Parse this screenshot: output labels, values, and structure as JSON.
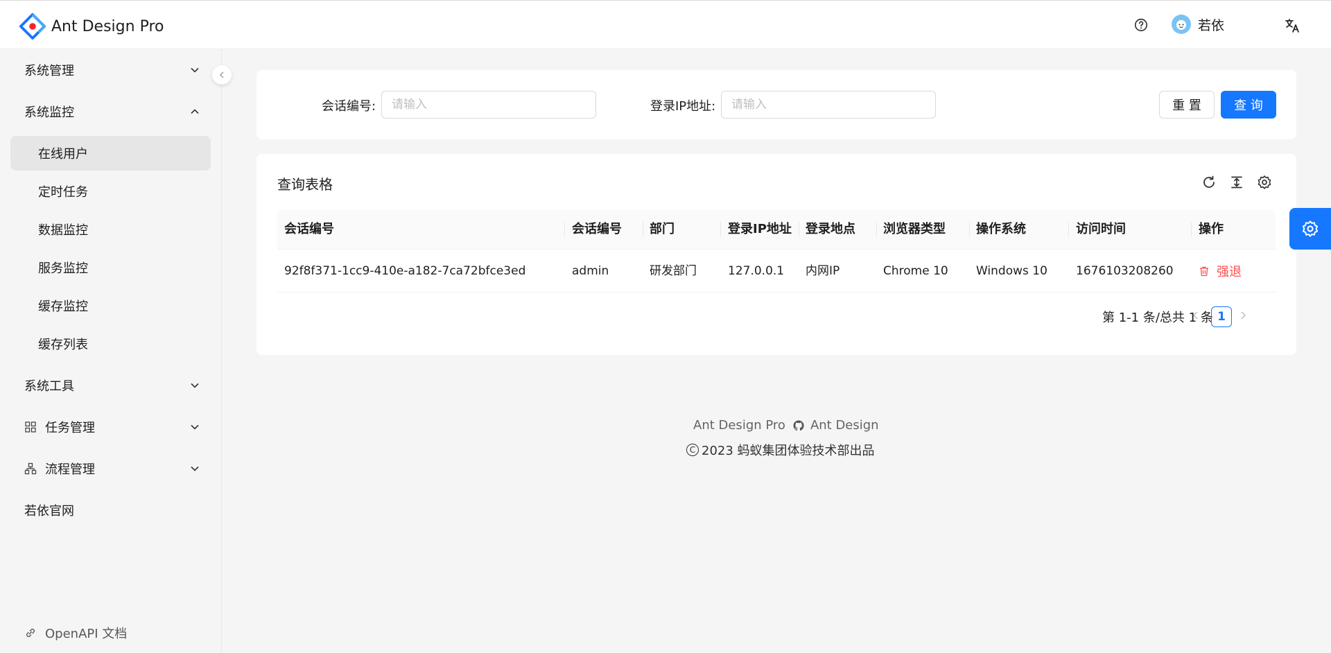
{
  "header": {
    "app_name": "Ant Design Pro",
    "user_name": "若依",
    "icons": {
      "help": "question-circle-icon",
      "language": "translation-icon"
    }
  },
  "sidebar": {
    "groups": [
      {
        "label": "系统管理",
        "expanded": false
      },
      {
        "label": "系统监控",
        "expanded": true,
        "items": [
          "在线用户",
          "定时任务",
          "数据监控",
          "服务监控",
          "缓存监控",
          "缓存列表"
        ]
      },
      {
        "label": "系统工具",
        "expanded": false
      },
      {
        "label": "任务管理",
        "expanded": false,
        "icon": "appstore-icon"
      },
      {
        "label": "流程管理",
        "expanded": false,
        "icon": "partition-icon"
      }
    ],
    "selected": "在线用户",
    "link": "若依官网",
    "openapi": "OpenAPI 文档"
  },
  "search": {
    "session_label": "会话编号:",
    "session_placeholder": "请输入",
    "ip_label": "登录IP地址:",
    "ip_placeholder": "请输入",
    "reset_label": "重 置",
    "query_label": "查 询"
  },
  "table": {
    "title": "查询表格",
    "columns": [
      "会话编号",
      "会话编号",
      "部门",
      "登录IP地址",
      "登录地点",
      "浏览器类型",
      "操作系统",
      "访问时间",
      "操作"
    ],
    "rows": [
      {
        "cells": [
          "92f8f371-1cc9-410e-a182-7ca72bfce3ed",
          "admin",
          "研发部门",
          "127.0.0.1",
          "内网IP",
          "Chrome 10",
          "Windows 10",
          "1676103208260"
        ],
        "action": "强退"
      }
    ],
    "pagination": {
      "summary": "第 1-1 条/总共 1 条",
      "current": "1"
    }
  },
  "footer": {
    "link1": "Ant Design Pro",
    "link2": "Ant Design",
    "copyright": "2023 蚂蚁集团体验技术部出品"
  },
  "colors": {
    "primary": "#1677ff",
    "danger": "#ff4d4f",
    "background": "#f5f5f5"
  }
}
